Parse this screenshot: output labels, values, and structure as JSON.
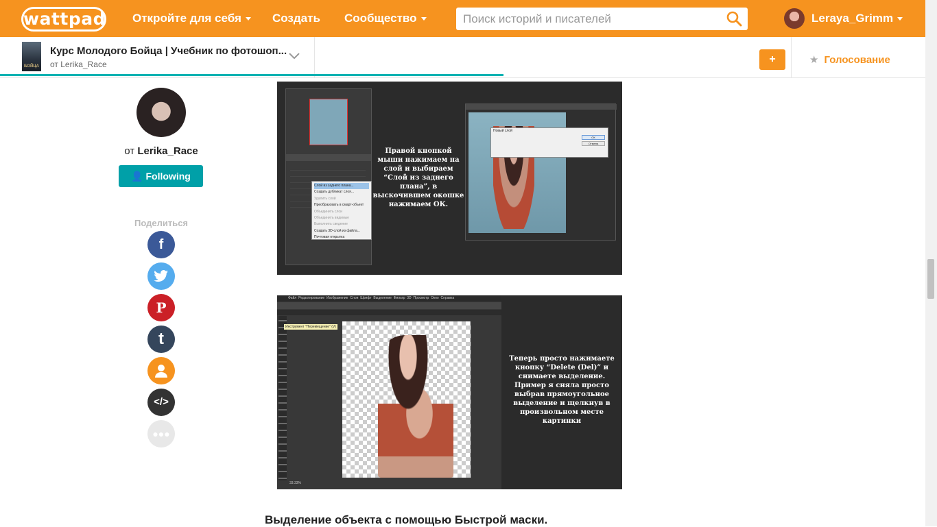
{
  "header": {
    "logo": "wattpad",
    "nav": [
      {
        "label": "Откройте для себя"
      },
      {
        "label": "Создать"
      },
      {
        "label": "Сообщество"
      }
    ],
    "search_placeholder": "Поиск историй и писателей",
    "username": "Leraya_Grimm",
    "brand_color": "#f6931f"
  },
  "story_bar": {
    "cover_text": "БОЙЦА",
    "title": "Курс Молодого Бойца | Учебник по фотошоп...",
    "author": "от Lerika_Race",
    "add_label": "+",
    "vote_label": "Голосование",
    "reading_progress": 0.537
  },
  "author": {
    "prefix": "от",
    "name": "Lerika_Race",
    "follow_label": "Following",
    "accent": "#00a0a8"
  },
  "share": {
    "label": "Поделиться",
    "items": [
      {
        "name": "facebook",
        "glyph": "f",
        "color": "#3b5998"
      },
      {
        "name": "twitter",
        "glyph": "t",
        "color": "#55acee"
      },
      {
        "name": "pinterest",
        "glyph": "P",
        "color": "#cb2027"
      },
      {
        "name": "tumblr",
        "glyph": "t",
        "color": "#35465c"
      },
      {
        "name": "profile",
        "glyph": "●",
        "color": "#f6931f"
      },
      {
        "name": "embed",
        "glyph": "</>",
        "color": "#333333"
      },
      {
        "name": "more",
        "glyph": "•••",
        "color": "#e8e8e8"
      }
    ]
  },
  "content": {
    "image1": {
      "caption": "Правой кнопкой мыши нажимаем на слой и выбираем “Слой из заднего плана”, в выскочившем окошке нажимаем ОК.",
      "menu_items": [
        "Слой из заднего плана...",
        "Создать дубликат слоя...",
        "Удалить слой",
        "Преобразовать в смарт-объект",
        "Объединить слои",
        "Объединить видимые",
        "Выполнить сведение",
        "Создать 3D-слой из файла...",
        "Почтовая открытка"
      ],
      "dialog_title": "Новый слой",
      "dialog_ok": "ОК",
      "dialog_cancel": "Отмена"
    },
    "image2": {
      "caption": "Теперь просто нажимаете кнопку “Delete (Del)” и снимаете выделение. Пример я сняла просто выбрав прямоугольное выделение и щелкнув в произвольном месте картинки",
      "menubar": [
        "Файл",
        "Редактирование",
        "Изображение",
        "Слои",
        "Шрифт",
        "Выделение",
        "Фильтр",
        "3D",
        "Просмотр",
        "Окно",
        "Справка"
      ],
      "tooltip": "Инструмент \"Перемещение\" (V)",
      "zoom": "33.33%"
    },
    "heading": "Выделение объекта с помощью Быстрой маски."
  }
}
